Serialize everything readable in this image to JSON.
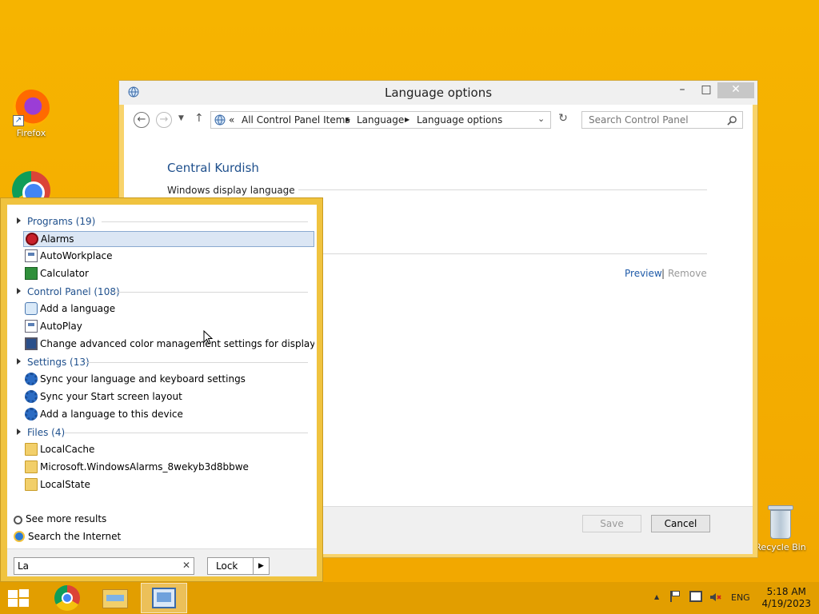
{
  "desktop": {
    "icons": [
      {
        "label": "Firefox"
      },
      {
        "label": ""
      },
      {
        "label": "Recycle Bin"
      }
    ]
  },
  "window": {
    "title": "Language options",
    "close_glyph": "✕",
    "minimize_glyph": "–",
    "maximize_glyph": "□",
    "breadcrumb": {
      "back_chevrons": "«",
      "items": [
        "All Control Panel Items",
        "Language",
        "Language options"
      ]
    },
    "search_placeholder": "Search Control Panel",
    "heading": "Central Kurdish",
    "section_label": "Windows display language",
    "links": {
      "preview": "Preview",
      "separator": "|",
      "remove": "Remove"
    },
    "buttons": {
      "save": "Save",
      "cancel": "Cancel"
    }
  },
  "search_pane": {
    "groups": [
      {
        "label": "Programs (19)",
        "items": [
          "Alarms",
          "AutoWorkplace",
          "Calculator"
        ]
      },
      {
        "label": "Control Panel (108)",
        "items": [
          "Add a language",
          "AutoPlay",
          "Change advanced color management settings for displays, sca..."
        ]
      },
      {
        "label": "Settings (13)",
        "items": [
          "Sync your language and keyboard settings",
          "Sync your Start screen layout",
          "Add a language to this device"
        ]
      },
      {
        "label": "Files (4)",
        "items": [
          "LocalCache",
          "Microsoft.WindowsAlarms_8wekyb3d8bbwe",
          "LocalState"
        ]
      }
    ],
    "see_more": "See more results",
    "search_internet": "Search the Internet",
    "query_value": "La",
    "clear_glyph": "✕",
    "lock_label": "Lock",
    "lock_arrow": "▶"
  },
  "taskbar": {
    "tray": {
      "language": "ENG",
      "time": "5:18 AM",
      "date": "4/19/2023",
      "show_hidden": "▲"
    }
  }
}
